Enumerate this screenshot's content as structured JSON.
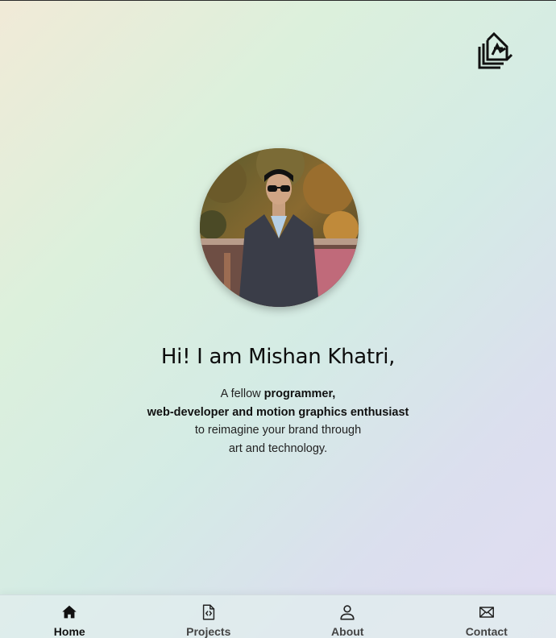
{
  "greeting": "Hi! I am Mishan Khatri,",
  "intro": {
    "prefix": "A fellow ",
    "role1": "programmer,",
    "role2": "web-developer and motion graphics enthusiast",
    "line3": "to reimagine your brand through",
    "line4": "art and technology."
  },
  "nav": {
    "items": [
      {
        "label": "Home",
        "icon": "home-icon",
        "active": true
      },
      {
        "label": "Projects",
        "icon": "file-code-icon",
        "active": false
      },
      {
        "label": "About",
        "icon": "user-icon",
        "active": false
      },
      {
        "label": "Contact",
        "icon": "mail-icon",
        "active": false
      }
    ]
  },
  "colors": {
    "text": "#111111",
    "nav_inactive": "#444444",
    "nav_active": "#111111"
  }
}
